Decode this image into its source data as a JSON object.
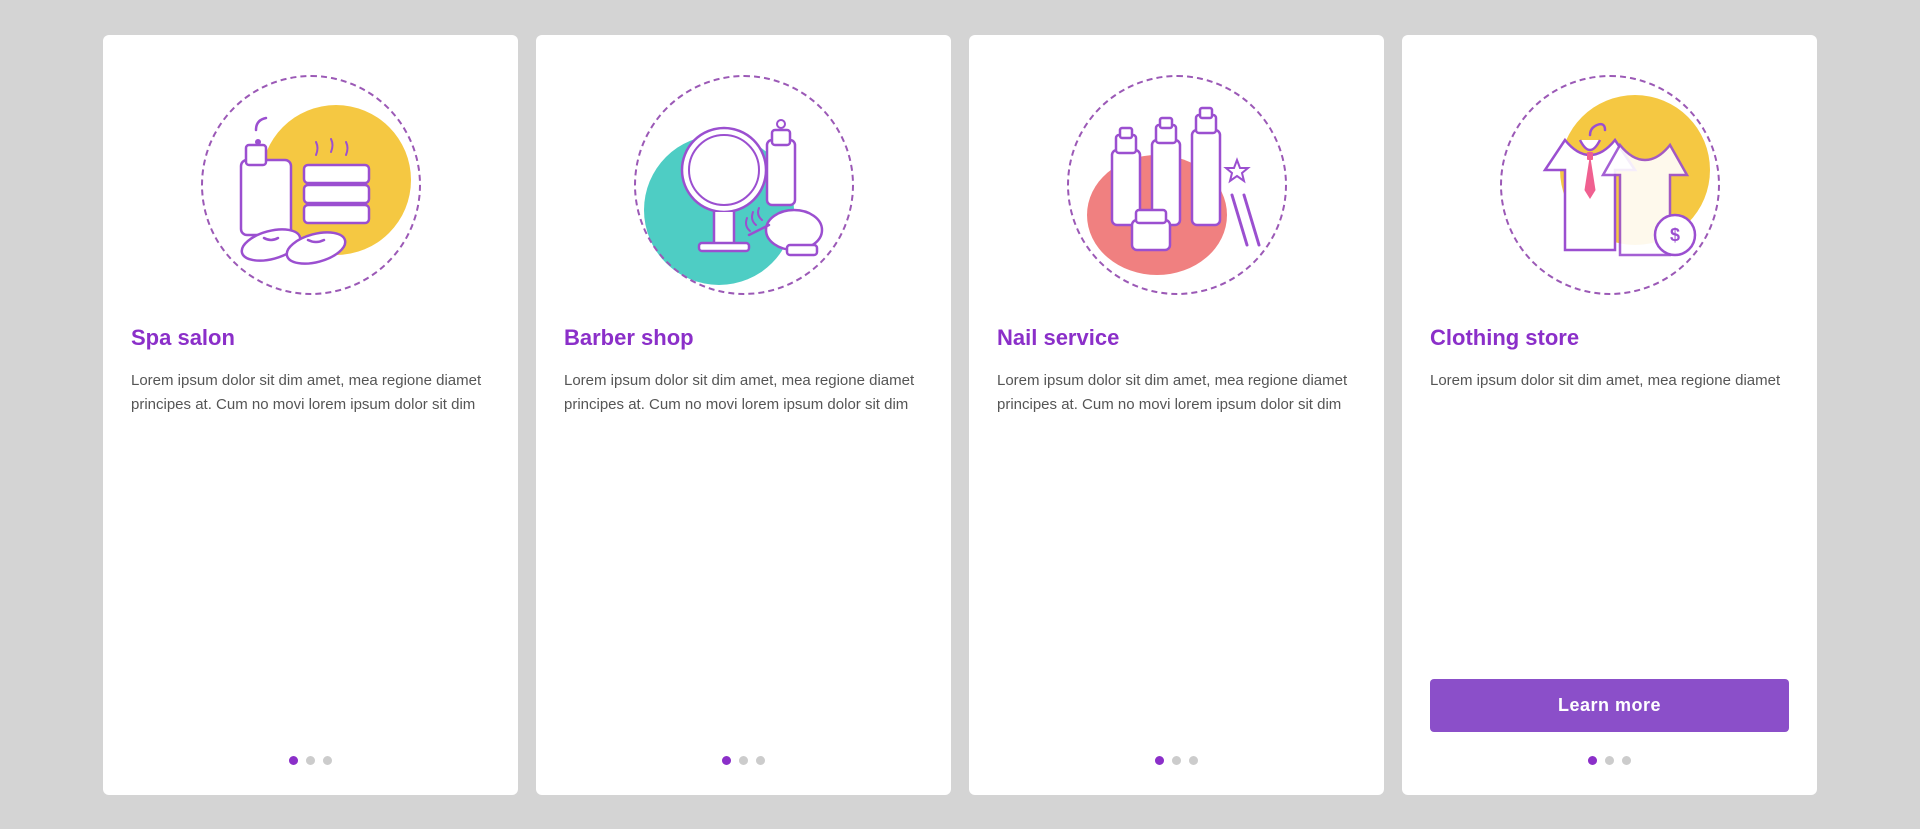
{
  "cards": [
    {
      "id": "spa-salon",
      "title": "Spa salon",
      "text": "Lorem ipsum dolor sit dim amet, mea regione diamet principes at. Cum no movi lorem ipsum dolor sit dim",
      "dots": [
        "active",
        "inactive",
        "inactive"
      ],
      "has_button": false,
      "icon_type": "spa",
      "blob_color": "#f5c842"
    },
    {
      "id": "barber-shop",
      "title": "Barber shop",
      "text": "Lorem ipsum dolor sit dim amet, mea regione diamet principes at. Cum no movi lorem ipsum dolor sit dim",
      "dots": [
        "active",
        "inactive",
        "inactive"
      ],
      "has_button": false,
      "icon_type": "barber",
      "blob_color": "#4ecdc4"
    },
    {
      "id": "nail-service",
      "title": "Nail service",
      "text": "Lorem ipsum dolor sit dim amet, mea regione diamet principes at. Cum no movi lorem ipsum dolor sit dim",
      "dots": [
        "active",
        "inactive",
        "inactive"
      ],
      "has_button": false,
      "icon_type": "nail",
      "blob_color": "#f08080"
    },
    {
      "id": "clothing-store",
      "title": "Clothing store",
      "text": "Lorem ipsum dolor sit dim amet, mea regione diamet",
      "dots": [
        "active",
        "inactive",
        "inactive"
      ],
      "has_button": true,
      "button_label": "Learn more",
      "icon_type": "clothing",
      "blob_color": "#f5c842"
    }
  ],
  "accent_color": "#8b2fc9",
  "button_color": "#9b4fd0"
}
